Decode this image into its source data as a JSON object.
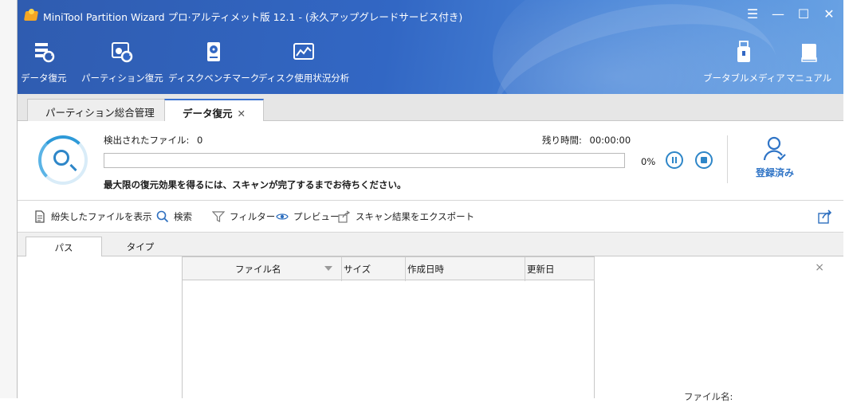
{
  "window": {
    "title": "MiniTool Partition Wizard プロ·アルティメット版 12.1 - (永久アップグレードサービス付き)",
    "controls": [
      "☰",
      "—",
      "☐",
      "✕"
    ]
  },
  "ribbon": {
    "left": [
      {
        "label": "データ復元",
        "icon": "data-recovery-icon"
      },
      {
        "label": "パーティション復元",
        "icon": "partition-recovery-icon"
      },
      {
        "label": "ディスクベンチマーク",
        "icon": "disk-benchmark-icon"
      },
      {
        "label": "ディスク使用状況分析",
        "icon": "space-analyzer-icon"
      }
    ],
    "right": [
      {
        "label": "ブータブルメディア",
        "icon": "bootable-media-icon"
      },
      {
        "label": "マニュアル",
        "icon": "manual-icon"
      }
    ]
  },
  "tabs": [
    {
      "label": "パーティション総合管理",
      "active": false
    },
    {
      "label": "データ復元",
      "active": true,
      "close": "✕"
    }
  ],
  "scan": {
    "found_label": "検出されたファイル:",
    "found_value": "0",
    "remaining_label": "残り時間:",
    "remaining_value": "00:00:00",
    "progress_percent": 0,
    "progress_text": "0%",
    "hint": "最大限の復元効果を得るには、スキャンが完了するまでお待ちください。",
    "registered": "登録済み"
  },
  "toolbar": {
    "show_lost": "紛失したファイルを表示",
    "search": "検索",
    "filter": "フィルター",
    "preview": "プレビュー",
    "export": "スキャン結果をエクスポート"
  },
  "subtabs": [
    "パス",
    "タイプ"
  ],
  "columns": [
    "ファイル名",
    "サイズ",
    "作成日時",
    "更新日"
  ],
  "preview": {
    "close": "×",
    "file_label": "ファイル名:"
  },
  "colors": {
    "accent": "#3b73d1",
    "header": "#3267c4",
    "icon_blue": "#2e86c8",
    "registered_blue": "#2f74c6"
  }
}
